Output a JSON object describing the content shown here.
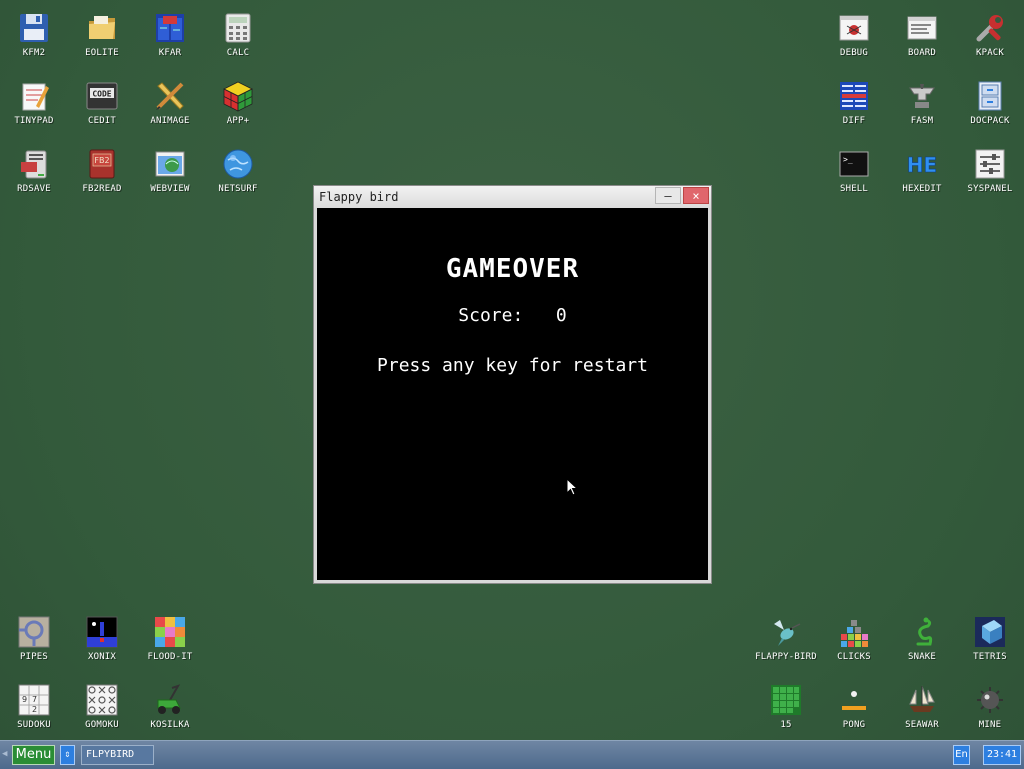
{
  "desktop": {
    "icons": {
      "kfm2": "KFM2",
      "eolite": "EOLITE",
      "kfar": "KFAR",
      "calc": "CALC",
      "tinypad": "TINYPAD",
      "cedit": "CEDIT",
      "animage": "ANIMAGE",
      "app_plus": "APP+",
      "rdsave": "RDSAVE",
      "fb2read": "FB2READ",
      "webview": "WEBVIEW",
      "netsurf": "NETSURF",
      "debug": "DEBUG",
      "board": "BOARD",
      "kpack": "KPACK",
      "diff": "DIFF",
      "fasm": "FASM",
      "docpack": "DOCPACK",
      "shell": "SHELL",
      "hexedit": "HEXEDIT",
      "syspanel": "SYSPANEL",
      "pipes": "PIPES",
      "xonix": "XONIX",
      "flood_it": "FLOOD-IT",
      "sudoku": "SUDOKU",
      "gomoku": "GOMOKU",
      "kosilka": "KOSILKA",
      "flappy_bird": "FLAPPY-BIRD",
      "clicks": "CLICKS",
      "snake": "SNAKE",
      "tetris": "TETRIS",
      "fifteen": "15",
      "pong": "PONG",
      "seawar": "SEAWAR",
      "mine": "MINE"
    },
    "icon_glyphs": {
      "cedit": "CODE",
      "fb2read": "FB2",
      "hexedit": "HE",
      "shell": ">_",
      "sudoku_grid": [
        "9",
        "7",
        "2"
      ]
    }
  },
  "window": {
    "title": "Flappy bird",
    "minimize_label": "–",
    "close_label": "×",
    "game": {
      "gameover": "GAMEOVER",
      "score_label": "Score:",
      "score_value": "0",
      "restart_hint": "Press any key for restart"
    }
  },
  "taskbar": {
    "menu_label": "Menu",
    "switch_label": "⇕",
    "task_label": "FLPYBIRD",
    "lang": "En",
    "clock": "23:41"
  },
  "colors": {
    "desktop": "#375a3f",
    "taskbar": "#5b7597",
    "menu_button": "#2a8d35",
    "accent_blue": "#2d7fe0",
    "close_button": "#e0666c"
  }
}
